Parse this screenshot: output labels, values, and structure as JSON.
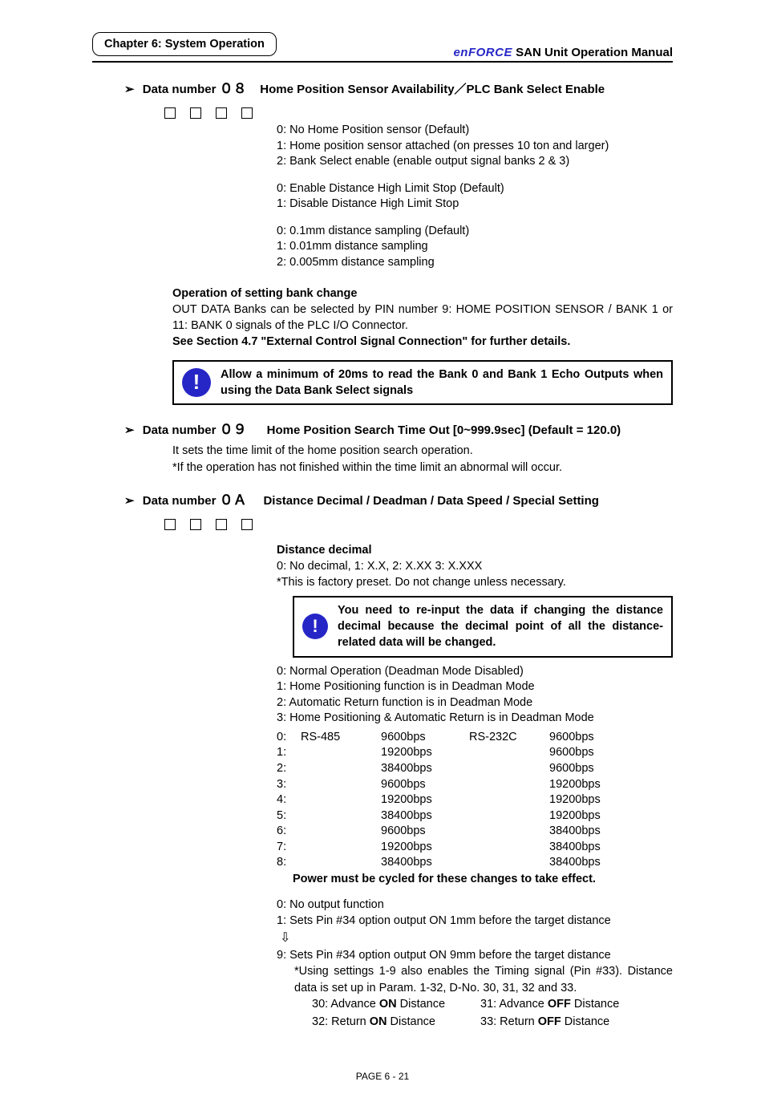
{
  "header": {
    "chapter": "Chapter 6: System Operation",
    "brand": "enFORCE",
    "manual": "SAN  Unit  Operation  Manual"
  },
  "dn08": {
    "title_prefix": "Data number",
    "num": "０８",
    "title_suffix": "Home Position Sensor Availability／PLC Bank Select Enable",
    "group1": {
      "l0": "0: No Home Position sensor (Default)",
      "l1": "1: Home position sensor attached (on presses 10 ton and larger)",
      "l2": "2: Bank Select enable (enable output signal banks 2 & 3)"
    },
    "group2": {
      "l0": "0: Enable Distance High Limit Stop (Default)",
      "l1": "1: Disable Distance High Limit Stop"
    },
    "group3": {
      "l0": "0: 0.1mm distance sampling (Default)",
      "l1": "1: 0.01mm distance sampling",
      "l2": "2: 0.005mm distance sampling"
    },
    "op_title": "Operation of setting bank change",
    "op_body": "OUT  DATA  Banks  can  be  selected  by  PIN  number  9:  HOME  POSITION  SENSOR  / BANK 1 or 11: BANK 0 signals of the PLC I/O Connector.",
    "op_see": "See Section 4.7 \"External Control Signal Connection\" for further details.",
    "note": "Allow  a  minimum  of  20ms  to  read  the  Bank  0  and  Bank  1  Echo  Outputs when using the Data Bank Select signals"
  },
  "dn09": {
    "title_prefix": "Data number",
    "num": "０９",
    "title_suffix": "Home Position Search Time Out    [0~999.9sec]      (Default = 120.0)",
    "l0": "It sets the time limit of the home position search operation.",
    "l1": "*If the operation has not finished within the time limit an abnormal will occur."
  },
  "dn0A": {
    "title_prefix": "Data number",
    "num": "０Ａ",
    "title_suffix": "Distance Decimal / Deadman / Data Speed / Special Setting",
    "dec_title": "Distance decimal",
    "dec_line": "0: No decimal,    1: X.X,    2: X.XX    3: X.XXX",
    "dec_note": "*This is factory preset. Do not change unless necessary.",
    "warn": "You need to re-input the data if changing the distance decimal because the decimal point of all the distance-related data will be changed.",
    "deadman": {
      "l0": "0: Normal Operation (Deadman Mode Disabled)",
      "l1": "1: Home Positioning function is in Deadman Mode",
      "l2": "2: Automatic Return function is in Deadman Mode",
      "l3": "3: Home Positioning & Automatic Return is in Deadman Mode"
    },
    "speed": {
      "h_rs485": "RS-485",
      "h_rs232": "RS-232C",
      "rows": [
        {
          "n": "0:",
          "a": "RS-485",
          "b": "9600bps",
          "c": "RS-232C",
          "d": "9600bps"
        },
        {
          "n": "1:",
          "a": "",
          "b": "19200bps",
          "c": "",
          "d": "9600bps"
        },
        {
          "n": "2:",
          "a": "",
          "b": "38400bps",
          "c": "",
          "d": "9600bps"
        },
        {
          "n": "3:",
          "a": "",
          "b": "9600bps",
          "c": "",
          "d": "19200bps"
        },
        {
          "n": "4:",
          "a": "",
          "b": "19200bps",
          "c": "",
          "d": "19200bps"
        },
        {
          "n": "5:",
          "a": "",
          "b": "38400bps",
          "c": "",
          "d": "19200bps"
        },
        {
          "n": "6:",
          "a": "",
          "b": "9600bps",
          "c": "",
          "d": "38400bps"
        },
        {
          "n": "7:",
          "a": "",
          "b": "19200bps",
          "c": "",
          "d": "38400bps"
        },
        {
          "n": "8:",
          "a": "",
          "b": "38400bps",
          "c": "",
          "d": "38400bps"
        }
      ],
      "note": "Power must be cycled for these changes to take effect."
    },
    "output": {
      "l0": "0: No output function",
      "l1": "1: Sets Pin #34 option output ON 1mm before the target distance",
      "arrow": "⇩",
      "l9": "9: Sets Pin #34 option output ON 9mm before the target distance",
      "using": "*Using  settings  1-9  also  enables  the  Timing  signal  (Pin  #33). Distance data is set up in Param. 1-32, D-No. 30, 31, 32 and 33.",
      "d30a": "30: Advance ",
      "d30b": "ON",
      "d30c": " Distance",
      "d31a": "31: Advance ",
      "d31b": "OFF",
      "d31c": " Distance",
      "d32a": "32: Return ",
      "d32b": "ON",
      "d32c": " Distance",
      "d33a": "33: Return ",
      "d33b": "OFF",
      "d33c": " Distance"
    }
  },
  "footer": "PAGE 6 - 21"
}
